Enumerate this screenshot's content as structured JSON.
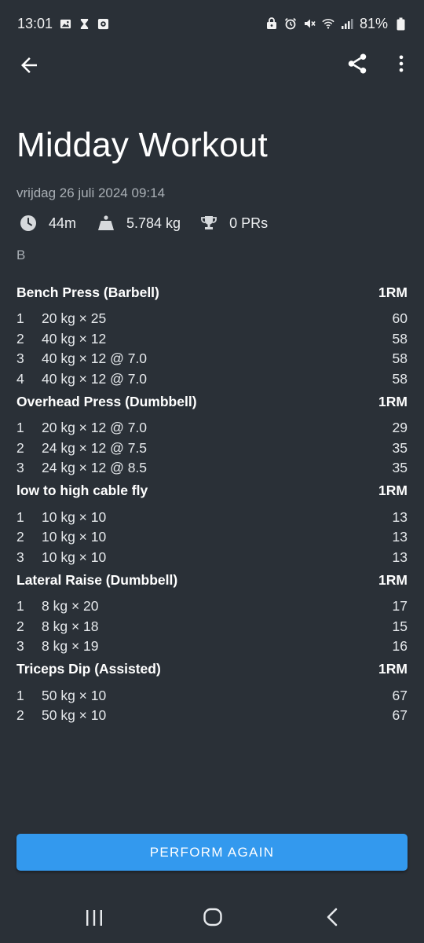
{
  "status_bar": {
    "time": "13:01",
    "battery": "81%",
    "left_icons": [
      "image-icon",
      "hourglass-icon",
      "app-icon"
    ],
    "right_icons": [
      "vpn-icon",
      "alarm-icon",
      "mute-icon",
      "wifi-icon",
      "signal-icon",
      "battery-icon"
    ]
  },
  "app_bar": {
    "back_icon": "arrow-left-icon",
    "share_icon": "share-icon",
    "more_icon": "more-vertical-icon"
  },
  "workout": {
    "title": "Midday Workout",
    "date": "vrijdag 26 juli 2024 09:14",
    "duration": "44m",
    "volume": "5.784 kg",
    "prs": "0 PRs",
    "note": "B"
  },
  "exercises": [
    {
      "name": "Bench Press (Barbell)",
      "column_label": "1RM",
      "sets": [
        {
          "num": "1",
          "desc": "20 kg × 25",
          "orm": "60"
        },
        {
          "num": "2",
          "desc": "40 kg × 12",
          "orm": "58"
        },
        {
          "num": "3",
          "desc": "40 kg × 12 @ 7.0",
          "orm": "58"
        },
        {
          "num": "4",
          "desc": "40 kg × 12 @ 7.0",
          "orm": "58"
        }
      ]
    },
    {
      "name": "Overhead Press (Dumbbell)",
      "column_label": "1RM",
      "sets": [
        {
          "num": "1",
          "desc": "20 kg × 12 @ 7.0",
          "orm": "29"
        },
        {
          "num": "2",
          "desc": "24 kg × 12 @ 7.5",
          "orm": "35"
        },
        {
          "num": "3",
          "desc": "24 kg × 12 @ 8.5",
          "orm": "35"
        }
      ]
    },
    {
      "name": "low to high cable fly",
      "column_label": "1RM",
      "sets": [
        {
          "num": "1",
          "desc": "10 kg × 10",
          "orm": "13"
        },
        {
          "num": "2",
          "desc": "10 kg × 10",
          "orm": "13"
        },
        {
          "num": "3",
          "desc": "10 kg × 10",
          "orm": "13"
        }
      ]
    },
    {
      "name": "Lateral Raise (Dumbbell)",
      "column_label": "1RM",
      "sets": [
        {
          "num": "1",
          "desc": "8 kg × 20",
          "orm": "17"
        },
        {
          "num": "2",
          "desc": "8 kg × 18",
          "orm": "15"
        },
        {
          "num": "3",
          "desc": "8 kg × 19",
          "orm": "16"
        }
      ]
    },
    {
      "name": "Triceps Dip (Assisted)",
      "column_label": "1RM",
      "sets": [
        {
          "num": "1",
          "desc": "50 kg × 10",
          "orm": "67"
        },
        {
          "num": "2",
          "desc": "50 kg × 10",
          "orm": "67"
        }
      ]
    }
  ],
  "actions": {
    "perform_again": "PERFORM AGAIN"
  },
  "colors": {
    "background": "#2a3037",
    "accent": "#3399ee",
    "secondary_text": "#a9afb5"
  }
}
